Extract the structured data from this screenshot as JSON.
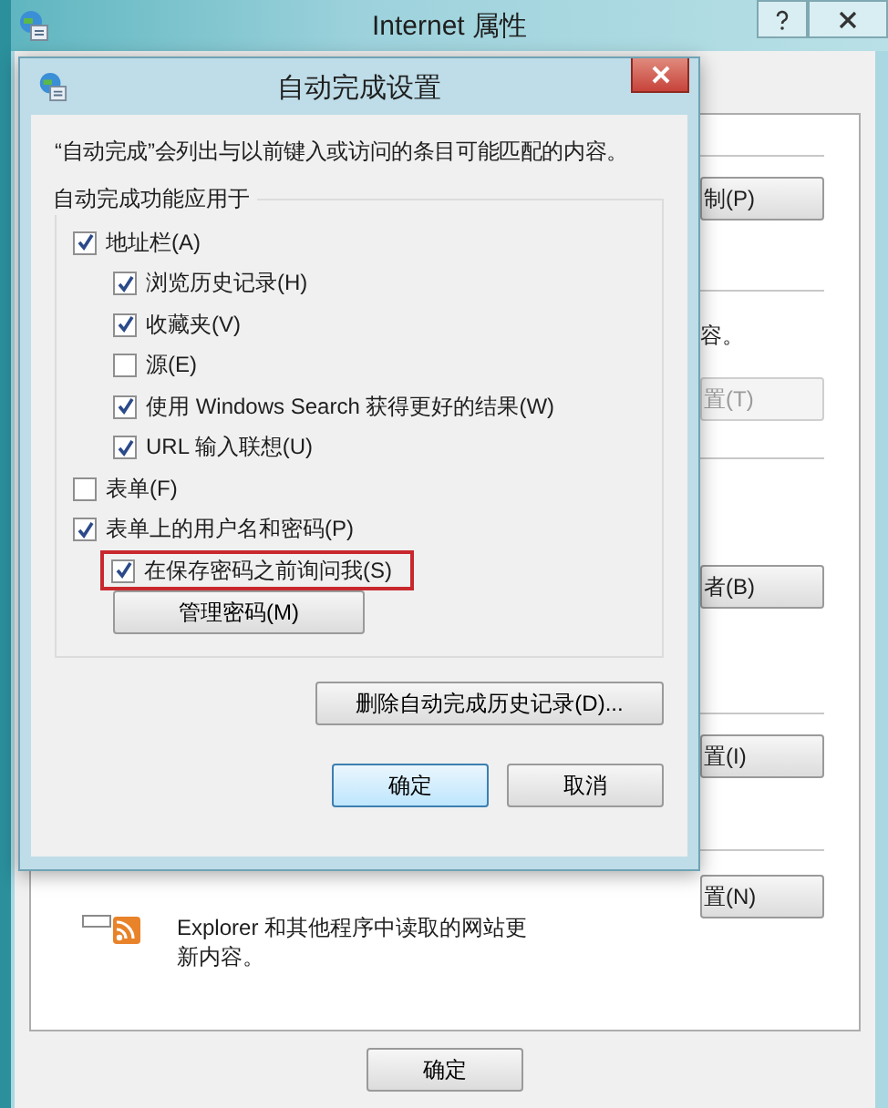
{
  "window": {
    "title": "Internet 属性"
  },
  "background": {
    "side_items": [
      {
        "kind": "button",
        "label": "制(P)",
        "disabled": false
      },
      {
        "kind": "text",
        "label": "容。"
      },
      {
        "kind": "button",
        "label": "置(T)",
        "disabled": true
      },
      {
        "kind": "button",
        "label": "者(B)",
        "disabled": false
      },
      {
        "kind": "button",
        "label": "置(I)",
        "disabled": false
      },
      {
        "kind": "button",
        "label": "置(N)",
        "disabled": false
      }
    ],
    "feed_text": [
      "Explorer 和其他程序中读取的网站更",
      "新内容。"
    ],
    "buttons": [
      {
        "label": "确定"
      }
    ]
  },
  "dialog": {
    "title": "自动完成设置",
    "description": "“自动完成”会列出与以前键入或访问的条目可能匹配的内容。",
    "group": {
      "title": "自动完成功能应用于",
      "options": [
        {
          "kind": "checkbox",
          "label": "地址栏(A)",
          "checked": true,
          "highlighted": false,
          "children": [
            {
              "kind": "checkbox",
              "label": "浏览历史记录(H)",
              "checked": true,
              "highlighted": false
            },
            {
              "kind": "checkbox",
              "label": "收藏夹(V)",
              "checked": true,
              "highlighted": false
            },
            {
              "kind": "checkbox",
              "label": "源(E)",
              "checked": false,
              "highlighted": false
            },
            {
              "kind": "checkbox",
              "label": "使用 Windows Search 获得更好的结果(W)",
              "checked": true,
              "highlighted": false
            },
            {
              "kind": "checkbox",
              "label": "URL 输入联想(U)",
              "checked": true,
              "highlighted": false
            }
          ]
        },
        {
          "kind": "checkbox",
          "label": "表单(F)",
          "checked": false,
          "highlighted": false
        },
        {
          "kind": "checkbox",
          "label": "表单上的用户名和密码(P)",
          "checked": true,
          "highlighted": false,
          "children": [
            {
              "kind": "checkbox",
              "label": "在保存密码之前询问我(S)",
              "checked": true,
              "highlighted": true
            },
            {
              "kind": "button",
              "label": "管理密码(M)"
            }
          ]
        }
      ]
    },
    "clear_button": "删除自动完成历史记录(D)...",
    "buttons": [
      {
        "label": "确定",
        "default": true
      },
      {
        "label": "取消",
        "default": false
      }
    ]
  }
}
